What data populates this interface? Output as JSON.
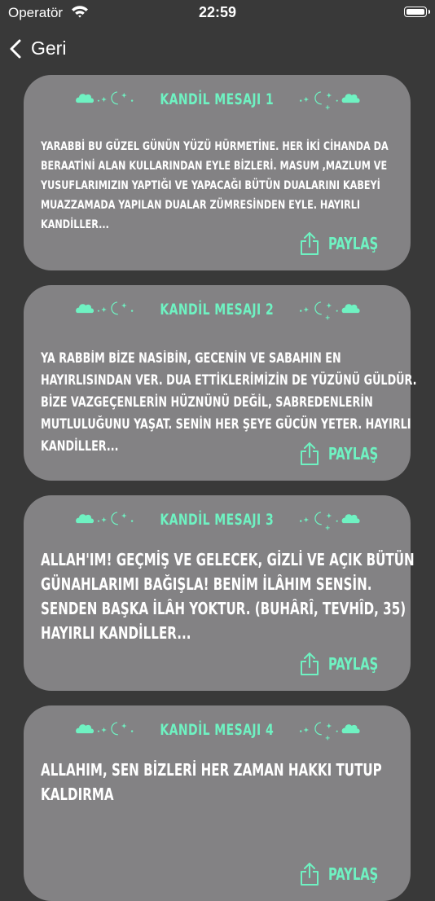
{
  "status_bar": {
    "carrier": "Operatör",
    "time": "22:59"
  },
  "nav": {
    "back_label": "Geri"
  },
  "colors": {
    "accent": "#6FF2C2",
    "card": "#838284",
    "background": "#393939"
  },
  "cards": [
    {
      "title": "KANDİL MESAJI 1",
      "message": "YARABBİ BU GÜZEL GÜNÜN YÜZÜ HÜRMETİNE. HER İKİ CİHANDA DA BERAATİNİ ALAN KULLARINDAN EYLE BİZLERİ. MASUM ,MAZLUM VE YUSUFLARIMIZIN YAPTIĞI VE YAPACAĞI BÜTÜN DUALARINI KABEYİ MUAZZAMADA YAPILAN DUALAR ZÜMRESİNDEN EYLE. HAYIRLI KANDİLLER...",
      "share_label": "PAYLAŞ"
    },
    {
      "title": "KANDİL MESAJI 2",
      "message": "YA RABBİM BİZE NASİBİN, GECENİN VE SABAHIN EN HAYIRLISINDAN VER. DUA ETTİKLERİMİZİN DE YÜZÜNÜ GÜLDÜR. BİZE VAZGEÇENLERİN HÜZNÜNÜ DEĞİL, SABREDENLERİN MUTLULUĞUNU YAŞAT. SENİN HER ŞEYE GÜCÜN YETER. HAYIRLI KANDİLLER...",
      "share_label": "PAYLAŞ"
    },
    {
      "title": "KANDİL MESAJI 3",
      "message": "ALLAH'IM! GEÇMİŞ VE GELECEK, GİZLİ VE AÇIK BÜTÜN GÜNAHLARIMI BAĞIŞLA! BENİM İLÂHIM SENSİN. SENDEN BAŞKA İLÂH YOKTUR. (BUHÂRÎ, TEVHÎD, 35) HAYIRLI KANDİLLER...",
      "share_label": "PAYLAŞ"
    },
    {
      "title": "KANDİL MESAJI 4",
      "message": "ALLAHIM, SEN BİZLERİ HER ZAMAN HAKKI TUTUP KALDIRMA",
      "share_label": "PAYLAŞ"
    }
  ]
}
